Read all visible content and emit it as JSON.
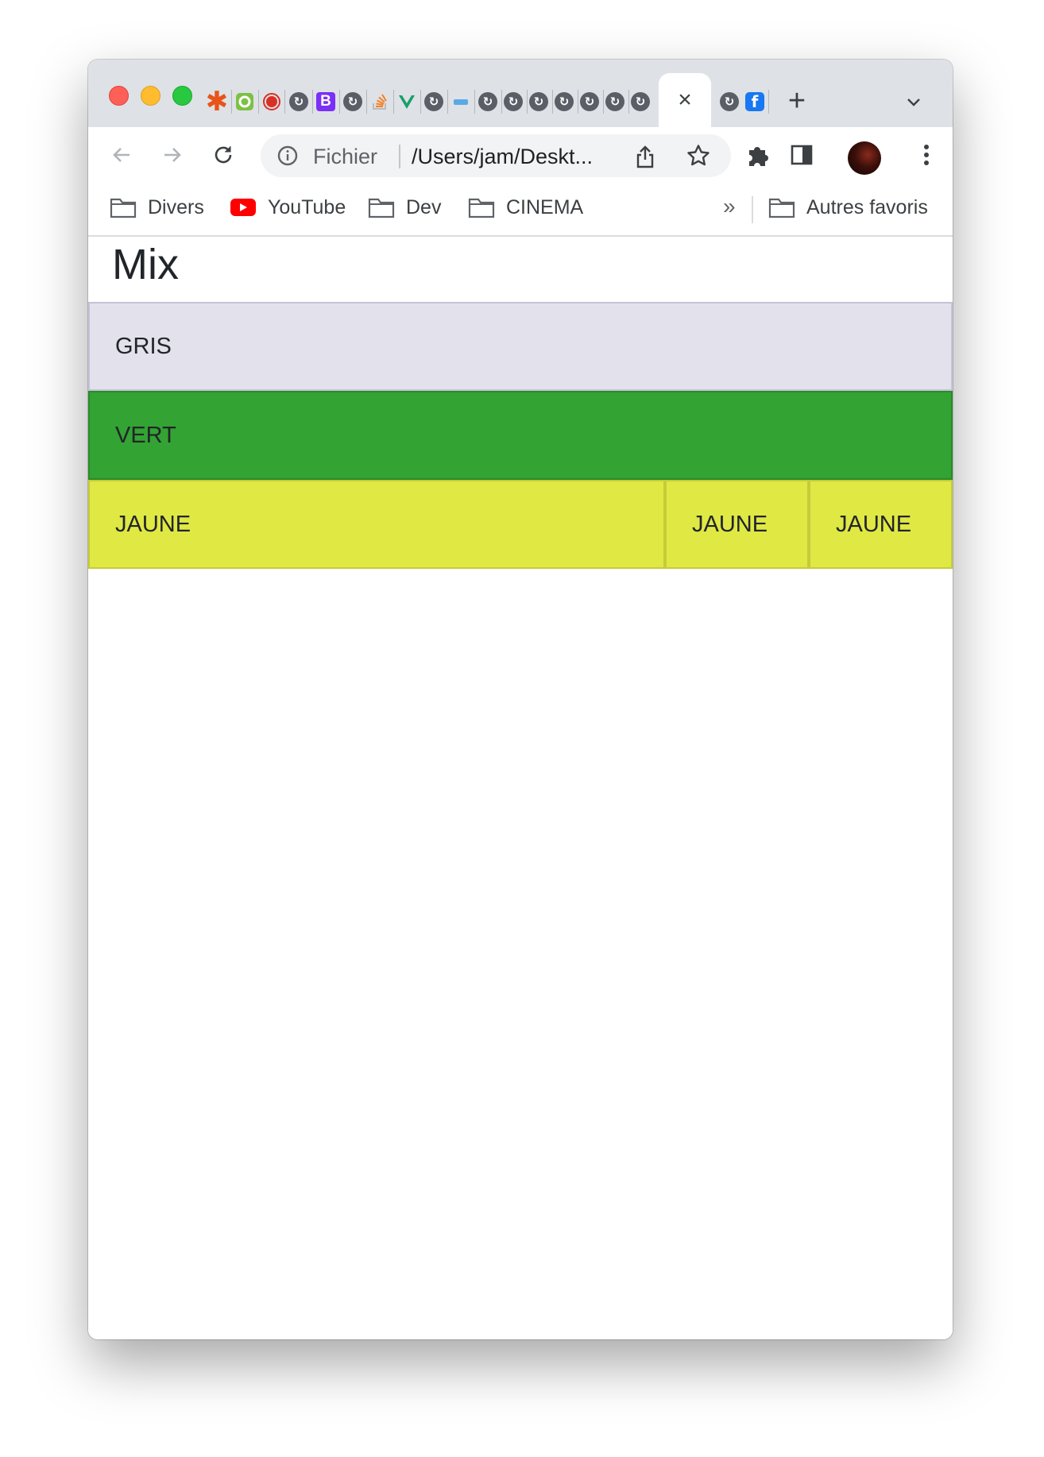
{
  "browser": {
    "active_tab_close": "×",
    "new_tab": "+",
    "tab_favicons": [
      "asterisk-icon",
      "refresh-green-icon",
      "record-icon",
      "globe-icon",
      "bootstrap-icon",
      "globe-icon",
      "stackoverflow-icon",
      "vue-icon",
      "globe-icon",
      "apidoc-icon",
      "globe-icon",
      "globe-icon",
      "globe-icon",
      "globe-icon",
      "globe-icon",
      "globe-icon",
      "globe-icon",
      "globe-icon",
      "facebook-icon"
    ],
    "tab_letter_b": "B",
    "tab_letter_f": "f",
    "omnibox": {
      "scheme": "Fichier",
      "url": "/Users/jam/Deskt..."
    },
    "bookmarks": {
      "items": [
        {
          "label": "Divers",
          "icon": "folder-icon"
        },
        {
          "label": "YouTube",
          "icon": "youtube-icon"
        },
        {
          "label": "Dev",
          "icon": "folder-icon"
        },
        {
          "label": "CINEMA",
          "icon": "folder-icon"
        }
      ],
      "overflow": "»",
      "other": "Autres favoris"
    }
  },
  "page": {
    "title": "Mix",
    "rows": {
      "gris": {
        "label": "GRIS",
        "color": "#e3e1ec"
      },
      "vert": {
        "label": "VERT",
        "color": "#33a333"
      },
      "jaune": {
        "labels": [
          "JAUNE",
          "JAUNE",
          "JAUNE"
        ],
        "color": "#e0e844"
      }
    }
  },
  "colors": {
    "tabstrip": "#dee1e6",
    "omnibox": "#f1f3f4"
  }
}
